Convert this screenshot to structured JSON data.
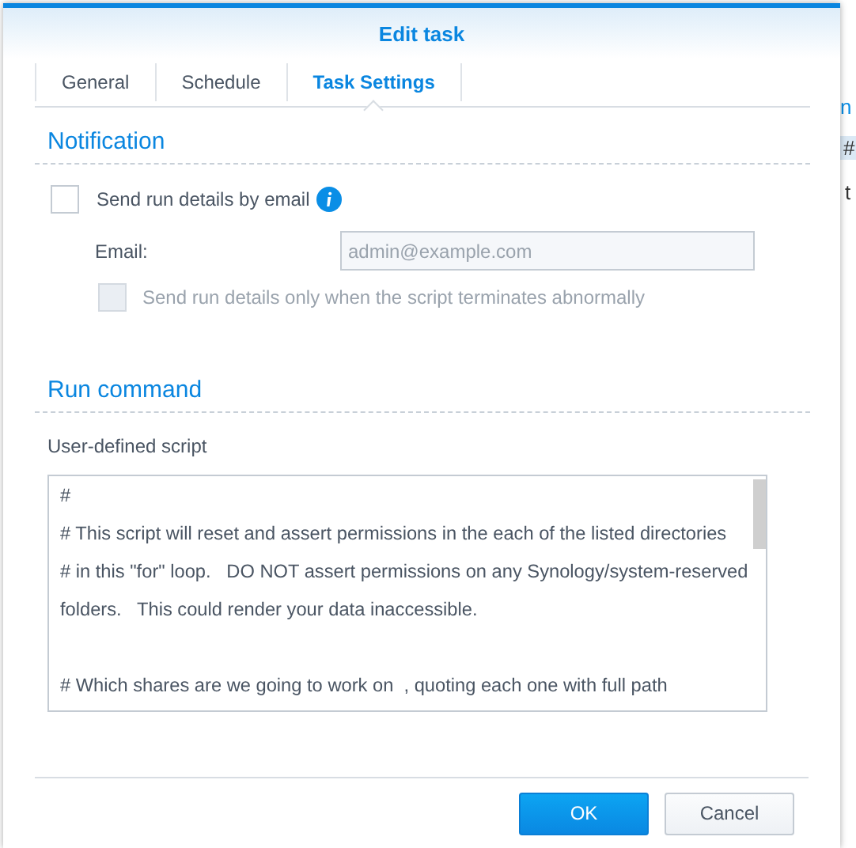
{
  "background": {
    "fragments": [
      "n",
      "#",
      "t"
    ]
  },
  "dialog": {
    "title": "Edit task"
  },
  "tabs": [
    {
      "label": "General",
      "selected": false
    },
    {
      "label": "Schedule",
      "selected": false
    },
    {
      "label": "Task Settings",
      "selected": true
    }
  ],
  "notification": {
    "heading": "Notification",
    "send_email": {
      "label": "Send run details by email",
      "checked": false
    },
    "email": {
      "label": "Email:",
      "value": "admin@example.com",
      "disabled": true
    },
    "abnormal_only": {
      "label": "Send run details only when the script terminates abnormally",
      "checked": false,
      "disabled": true
    }
  },
  "run_command": {
    "heading": "Run command",
    "label": "User-defined script",
    "script": "#\n# This script will reset and assert permissions in the each of the listed directories\n# in this \"for\" loop.   DO NOT assert permissions on any Synology/system-reserved folders.   This could render your data inaccessible.\n\n# Which shares are we going to work on  , quoting each one with full path"
  },
  "buttons": [
    {
      "label": "OK",
      "kind": "primary"
    },
    {
      "label": "Cancel",
      "kind": "secondary"
    }
  ]
}
